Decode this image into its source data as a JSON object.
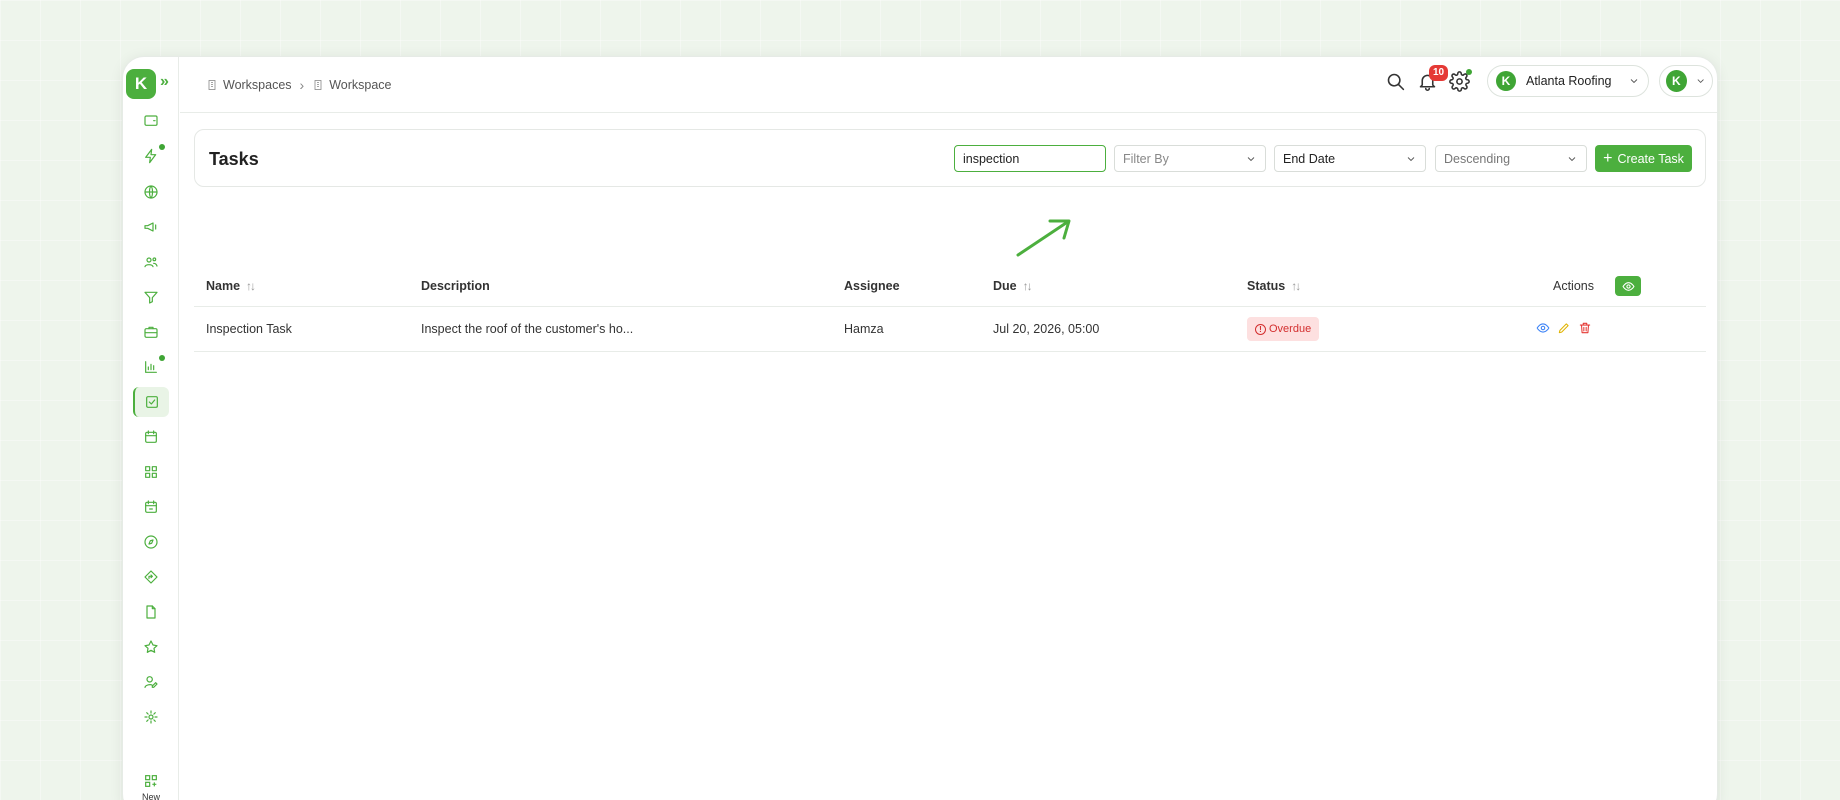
{
  "breadcrumb": {
    "items": [
      "Workspaces",
      "Workspace"
    ]
  },
  "topbar": {
    "notifications_count": "10",
    "account_name": "Atlanta Roofing",
    "avatar_letter": "K"
  },
  "logo": {
    "letter": "K"
  },
  "sidebar": {
    "new_label": "New"
  },
  "header": {
    "title": "Tasks",
    "search_value": "inspection",
    "filter_by": "Filter By",
    "end_date": "End Date",
    "order": "Descending",
    "create_label": "Create Task"
  },
  "table": {
    "headers": {
      "name": "Name",
      "description": "Description",
      "assignee": "Assignee",
      "due": "Due",
      "status": "Status",
      "actions": "Actions"
    },
    "rows": [
      {
        "name": "Inspection Task",
        "description": "Inspect the roof of the customer's ho...",
        "assignee": "Hamza",
        "due": "Jul 20, 2026, 05:00",
        "status": "Overdue"
      }
    ]
  },
  "colors": {
    "accent": "#4caf3e",
    "danger": "#d32f2f",
    "danger_bg": "#fde0e0"
  }
}
